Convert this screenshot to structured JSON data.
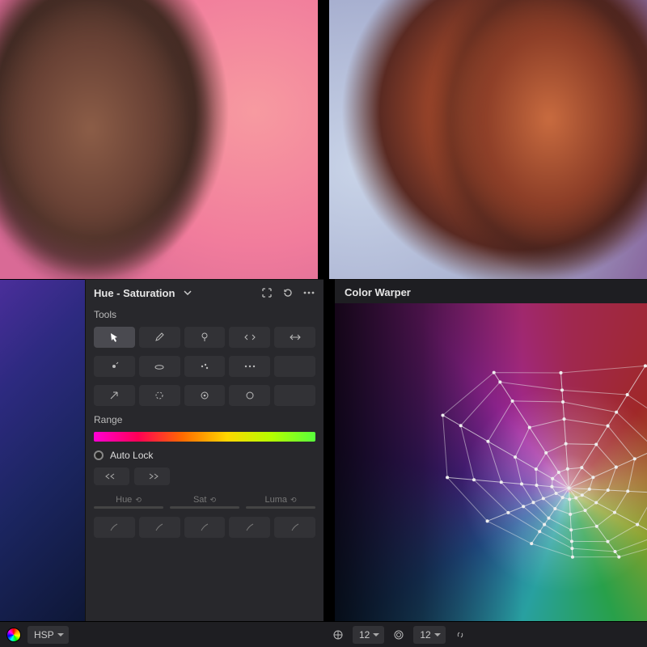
{
  "left_panel": {
    "title": "Hue - Saturation",
    "sections": {
      "tools_label": "Tools",
      "range_label": "Range",
      "autolock_label": "Auto Lock"
    },
    "hsl": {
      "hue": "Hue",
      "sat": "Sat",
      "luma": "Luma"
    },
    "mode_dropdown": "HSP"
  },
  "right_panel": {
    "title": "Color Warper",
    "controls": {
      "radial_divisions": "12",
      "angular_divisions": "12"
    }
  },
  "icons": {
    "chevron_down": "chevron-down-icon",
    "expand": "expand-icon",
    "reset": "reset-icon",
    "more": "more-icon",
    "pointer": "pointer-icon",
    "pencil": "pencil-icon",
    "pin": "pin-icon",
    "contract": "contract-icon",
    "spread": "spread-icon",
    "add_pt": "add-point-icon",
    "lasso": "lasso-icon",
    "cluster": "cluster-icon",
    "dots3": "three-dots-icon",
    "arrow": "arrow-icon",
    "circ_sel": "circle-select-icon",
    "target": "target-icon",
    "ring": "ring-icon",
    "left_arrows": "nudge-left-icon",
    "right_arrows": "nudge-right-icon",
    "brush": "brush-icon",
    "eraser": "eraser-icon",
    "link": "link-icon",
    "wheel": "color-wheel-icon",
    "grid": "grid-icon"
  }
}
